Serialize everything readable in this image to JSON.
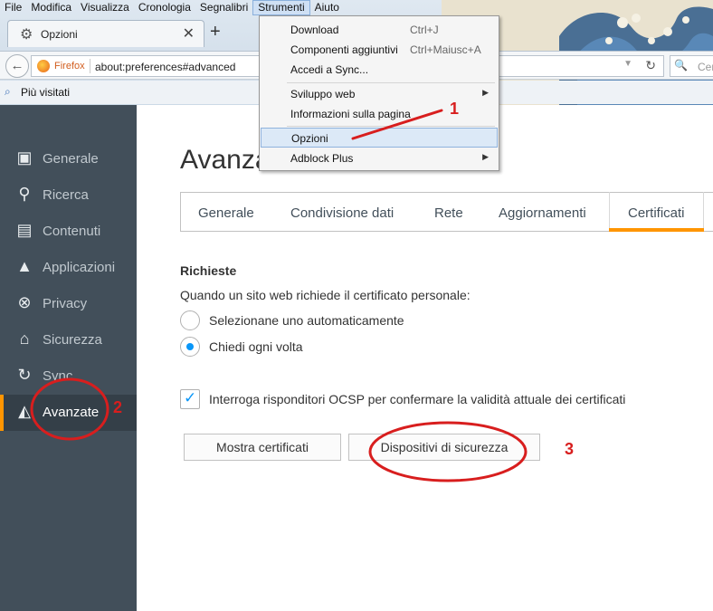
{
  "menubar": {
    "items": [
      {
        "label": "File"
      },
      {
        "label": "Modifica"
      },
      {
        "label": "Visualizza"
      },
      {
        "label": "Cronologia"
      },
      {
        "label": "Segnalibri"
      },
      {
        "label": "Strumenti"
      },
      {
        "label": "Aiuto"
      }
    ]
  },
  "tab": {
    "title": "Opzioni",
    "icon": "gear-icon"
  },
  "navbar": {
    "identity": "Firefox",
    "url": "about:preferences#advanced",
    "search_placeholder": "Cer"
  },
  "bookmarks": {
    "label": "Più visitati"
  },
  "sidebar": {
    "items": [
      {
        "label": "Generale",
        "icon": "general-icon"
      },
      {
        "label": "Ricerca",
        "icon": "search-icon"
      },
      {
        "label": "Contenuti",
        "icon": "document-icon"
      },
      {
        "label": "Applicazioni",
        "icon": "rocket-icon"
      },
      {
        "label": "Privacy",
        "icon": "mask-icon"
      },
      {
        "label": "Sicurezza",
        "icon": "lock-icon"
      },
      {
        "label": "Sync",
        "icon": "sync-icon"
      },
      {
        "label": "Avanzate",
        "icon": "advanced-icon",
        "selected": true
      }
    ]
  },
  "main": {
    "title": "Avanzate",
    "tabs": [
      {
        "label": "Generale"
      },
      {
        "label": "Condivisione dati"
      },
      {
        "label": "Rete"
      },
      {
        "label": "Aggiornamenti"
      },
      {
        "label": "Certificati",
        "selected": true
      }
    ],
    "requests": {
      "heading": "Richieste",
      "description": "Quando un sito web richiede il certificato personale:",
      "option_auto": "Selezionane uno automaticamente",
      "option_ask": "Chiedi ogni volta",
      "selected": "ask"
    },
    "ocsp": {
      "label": "Interroga risponditori OCSP per confermare la validità attuale dei certificati",
      "checked": true
    },
    "buttons": {
      "show_certificates": "Mostra certificati",
      "security_devices": "Dispositivi di sicurezza"
    }
  },
  "strumenti_menu": {
    "items": [
      {
        "label": "Download",
        "shortcut": "Ctrl+J"
      },
      {
        "label": "Componenti aggiuntivi",
        "shortcut": "Ctrl+Maiusc+A"
      },
      {
        "label": "Accedi a Sync..."
      },
      {
        "label": "Sviluppo web",
        "submenu": true
      },
      {
        "label": "Informazioni sulla pagina"
      },
      {
        "label": "Opzioni",
        "highlighted": true
      },
      {
        "label": "Adblock Plus",
        "submenu": true
      }
    ]
  },
  "annotations": {
    "step1": "1",
    "step2": "2",
    "step3": "3",
    "color": "#d81e1e"
  },
  "colors": {
    "accent": "#ff9500",
    "sidebar_bg": "#424f5a",
    "checkbox_blue": "#0996f8"
  }
}
